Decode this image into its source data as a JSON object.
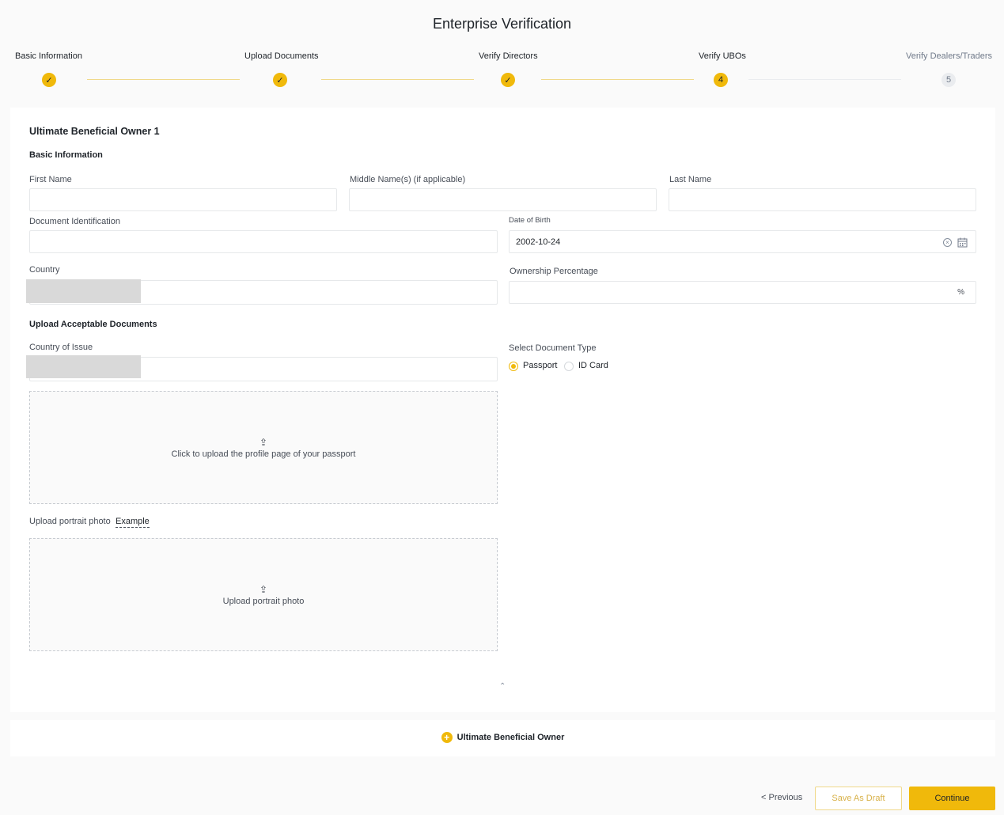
{
  "page": {
    "title": "Enterprise Verification"
  },
  "stepper": {
    "steps": [
      {
        "label": "Basic Information",
        "state": "done",
        "marker": "✓"
      },
      {
        "label": "Upload Documents",
        "state": "done",
        "marker": "✓"
      },
      {
        "label": "Verify Directors",
        "state": "done",
        "marker": "✓"
      },
      {
        "label": "Verify UBOs",
        "state": "active",
        "marker": "4"
      },
      {
        "label": "Verify Dealers/Traders",
        "state": "pending",
        "marker": "5"
      }
    ]
  },
  "form": {
    "owner_title": "Ultimate Beneficial Owner 1",
    "basic_section": "Basic Information",
    "first_name": {
      "label": "First Name",
      "value": ""
    },
    "middle_name": {
      "label": "Middle Name(s) (if applicable)",
      "value": ""
    },
    "last_name": {
      "label": "Last Name",
      "value": ""
    },
    "document_id": {
      "label": "Document Identification",
      "value": ""
    },
    "dob": {
      "label": "Date of Birth",
      "value": "2002-10-24"
    },
    "country": {
      "label": "Country",
      "value": ""
    },
    "ownership": {
      "label": "Ownership Percentage",
      "value": "",
      "suffix": "%"
    },
    "upload_section": "Upload Acceptable Documents",
    "country_of_issue": {
      "label": "Country of Issue",
      "value": ""
    },
    "doc_type": {
      "label": "Select Document Type",
      "options": [
        "Passport",
        "ID Card"
      ],
      "selected": "Passport"
    },
    "passport_upload_text": "Click to upload the profile page of your passport",
    "portrait_label": "Upload portrait photo",
    "portrait_example": "Example",
    "portrait_upload_text": "Upload portrait photo"
  },
  "add_owner_label": "Ultimate Beneficial Owner",
  "footer": {
    "previous": "< Previous",
    "save_draft": "Save As Draft",
    "continue": "Continue"
  },
  "icons": {
    "check": "check-icon",
    "upload": "upload-icon",
    "calendar": "calendar-icon",
    "clear": "clear-icon",
    "plus": "plus-circle-icon",
    "collapse": "double-chevron-up-icon"
  },
  "colors": {
    "accent": "#f0b90b",
    "text": "#1e2329",
    "muted": "#707a8a"
  }
}
